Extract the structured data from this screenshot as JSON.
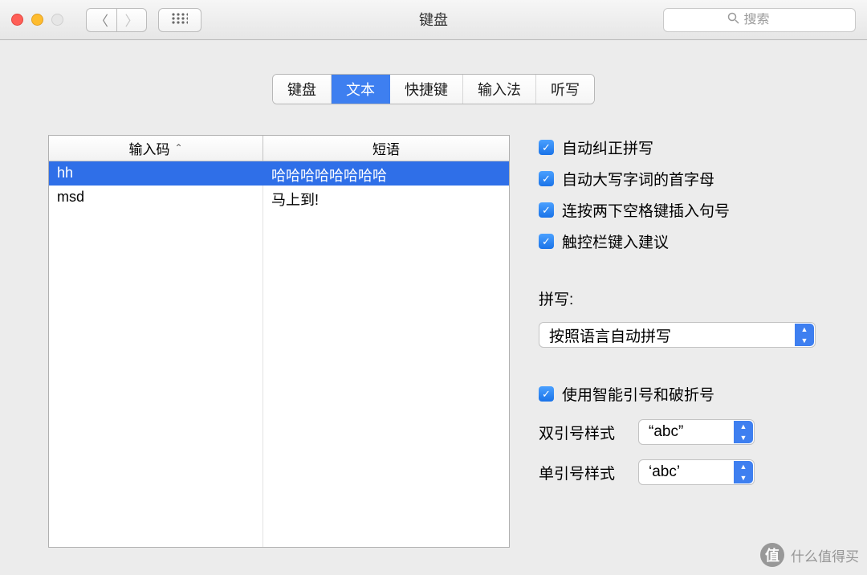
{
  "window": {
    "title": "键盘"
  },
  "toolbar": {
    "search_placeholder": "搜索"
  },
  "tabs": [
    {
      "label": "键盘",
      "id": "keyboard",
      "active": false
    },
    {
      "label": "文本",
      "id": "text",
      "active": true
    },
    {
      "label": "快捷键",
      "id": "shortcuts",
      "active": false
    },
    {
      "label": "输入法",
      "id": "input",
      "active": false
    },
    {
      "label": "听写",
      "id": "dictation",
      "active": false
    }
  ],
  "table": {
    "columns": {
      "code": "输入码",
      "phrase": "短语"
    },
    "rows": [
      {
        "code": "hh",
        "phrase": "哈哈哈哈哈哈哈哈",
        "selected": true
      },
      {
        "code": "msd",
        "phrase": "马上到!",
        "selected": false
      }
    ]
  },
  "options": {
    "autocorrect": {
      "label": "自动纠正拼写",
      "checked": true
    },
    "capitalize": {
      "label": "自动大写字词的首字母",
      "checked": true
    },
    "double_space": {
      "label": "连按两下空格键插入句号",
      "checked": true
    },
    "touchbar": {
      "label": "触控栏键入建议",
      "checked": true
    },
    "smart_quotes": {
      "label": "使用智能引号和破折号",
      "checked": true
    }
  },
  "spelling": {
    "label": "拼写:",
    "value": "按照语言自动拼写"
  },
  "quotes": {
    "double": {
      "label": "双引号样式",
      "value": "“abc”"
    },
    "single": {
      "label": "单引号样式",
      "value": "‘abc’"
    }
  },
  "watermark": {
    "badge": "值",
    "text": "什么值得买"
  }
}
